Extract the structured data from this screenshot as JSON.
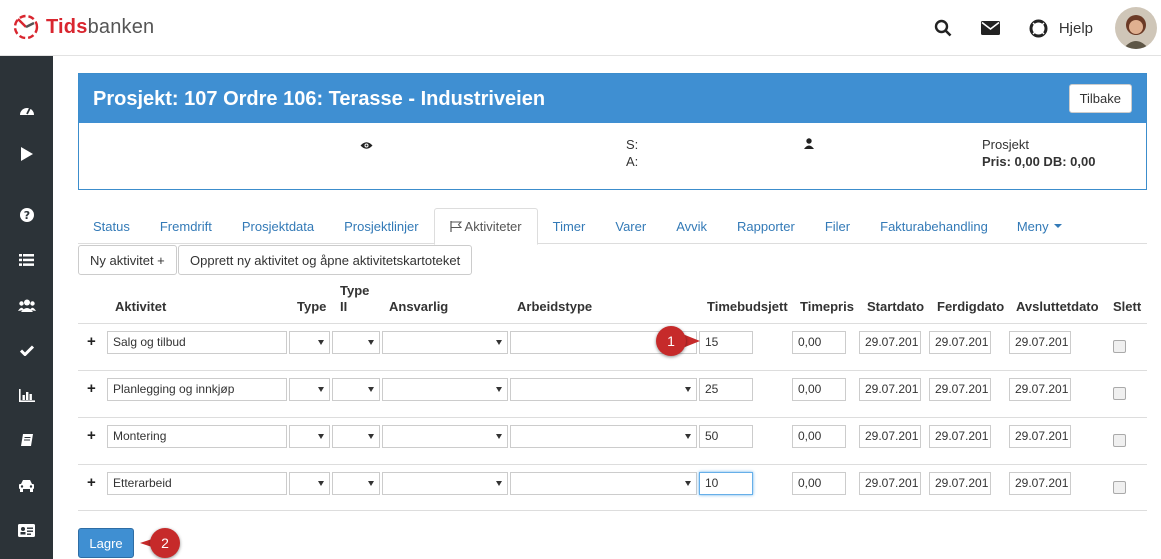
{
  "app": {
    "logo_part1": "Tids",
    "logo_part2": "banken",
    "help_label": "Hjelp"
  },
  "sidebar": {
    "items": [
      "dashboard-icon",
      "play-icon",
      "question-icon",
      "list-icon",
      "users-icon",
      "check-icon",
      "chart-icon",
      "book-icon",
      "car-icon",
      "id-card-icon"
    ]
  },
  "project": {
    "title": "Prosjekt: 107 Ordre 106: Terasse - Industriveien",
    "back_label": "Tilbake",
    "s_label": "S:",
    "a_label": "A:",
    "type_label": "Prosjekt",
    "price_label": "Pris: 0,00 DB: 0,00"
  },
  "tabs": [
    "Status",
    "Fremdrift",
    "Prosjektdata",
    "Prosjektlinjer",
    "Aktiviteter",
    "Timer",
    "Varer",
    "Avvik",
    "Rapporter",
    "Filer",
    "Fakturabehandling",
    "Meny"
  ],
  "active_tab": "Aktiviteter",
  "actions": {
    "new_activity": "Ny aktivitet +",
    "new_activity_open": "Opprett ny aktivitet og åpne aktivitetskartoteket",
    "save": "Lagre"
  },
  "table": {
    "headers": {
      "aktivitet": "Aktivitet",
      "type": "Type",
      "type2_line1": "Type",
      "type2_line2": "II",
      "ansvarlig": "Ansvarlig",
      "arbeidstype": "Arbeidstype",
      "timebudsjett": "Timebudsjett",
      "timepris": "Timepris",
      "startdato": "Startdato",
      "ferdigdato": "Ferdigdato",
      "avsluttetdato": "Avsluttetdato",
      "slett": "Slett"
    },
    "rows": [
      {
        "name": "Salg og tilbud",
        "budget": "15",
        "price": "0,00",
        "start": "29.07.201",
        "end": "29.07.201",
        "closed": "29.07.201"
      },
      {
        "name": "Planlegging og innkjøp",
        "budget": "25",
        "price": "0,00",
        "start": "29.07.201",
        "end": "29.07.201",
        "closed": "29.07.201"
      },
      {
        "name": "Montering",
        "budget": "50",
        "price": "0,00",
        "start": "29.07.201",
        "end": "29.07.201",
        "closed": "29.07.201"
      },
      {
        "name": "Etterarbeid",
        "budget": "10",
        "price": "0,00",
        "start": "29.07.201",
        "end": "29.07.201",
        "closed": "29.07.201"
      }
    ]
  },
  "callouts": {
    "one": "1",
    "two": "2"
  },
  "colors": {
    "primary": "#3f8fd2",
    "brand_red": "#d9262f",
    "sidebar": "#2c3338",
    "badge": "#c62a2a",
    "link": "#337ab7"
  }
}
